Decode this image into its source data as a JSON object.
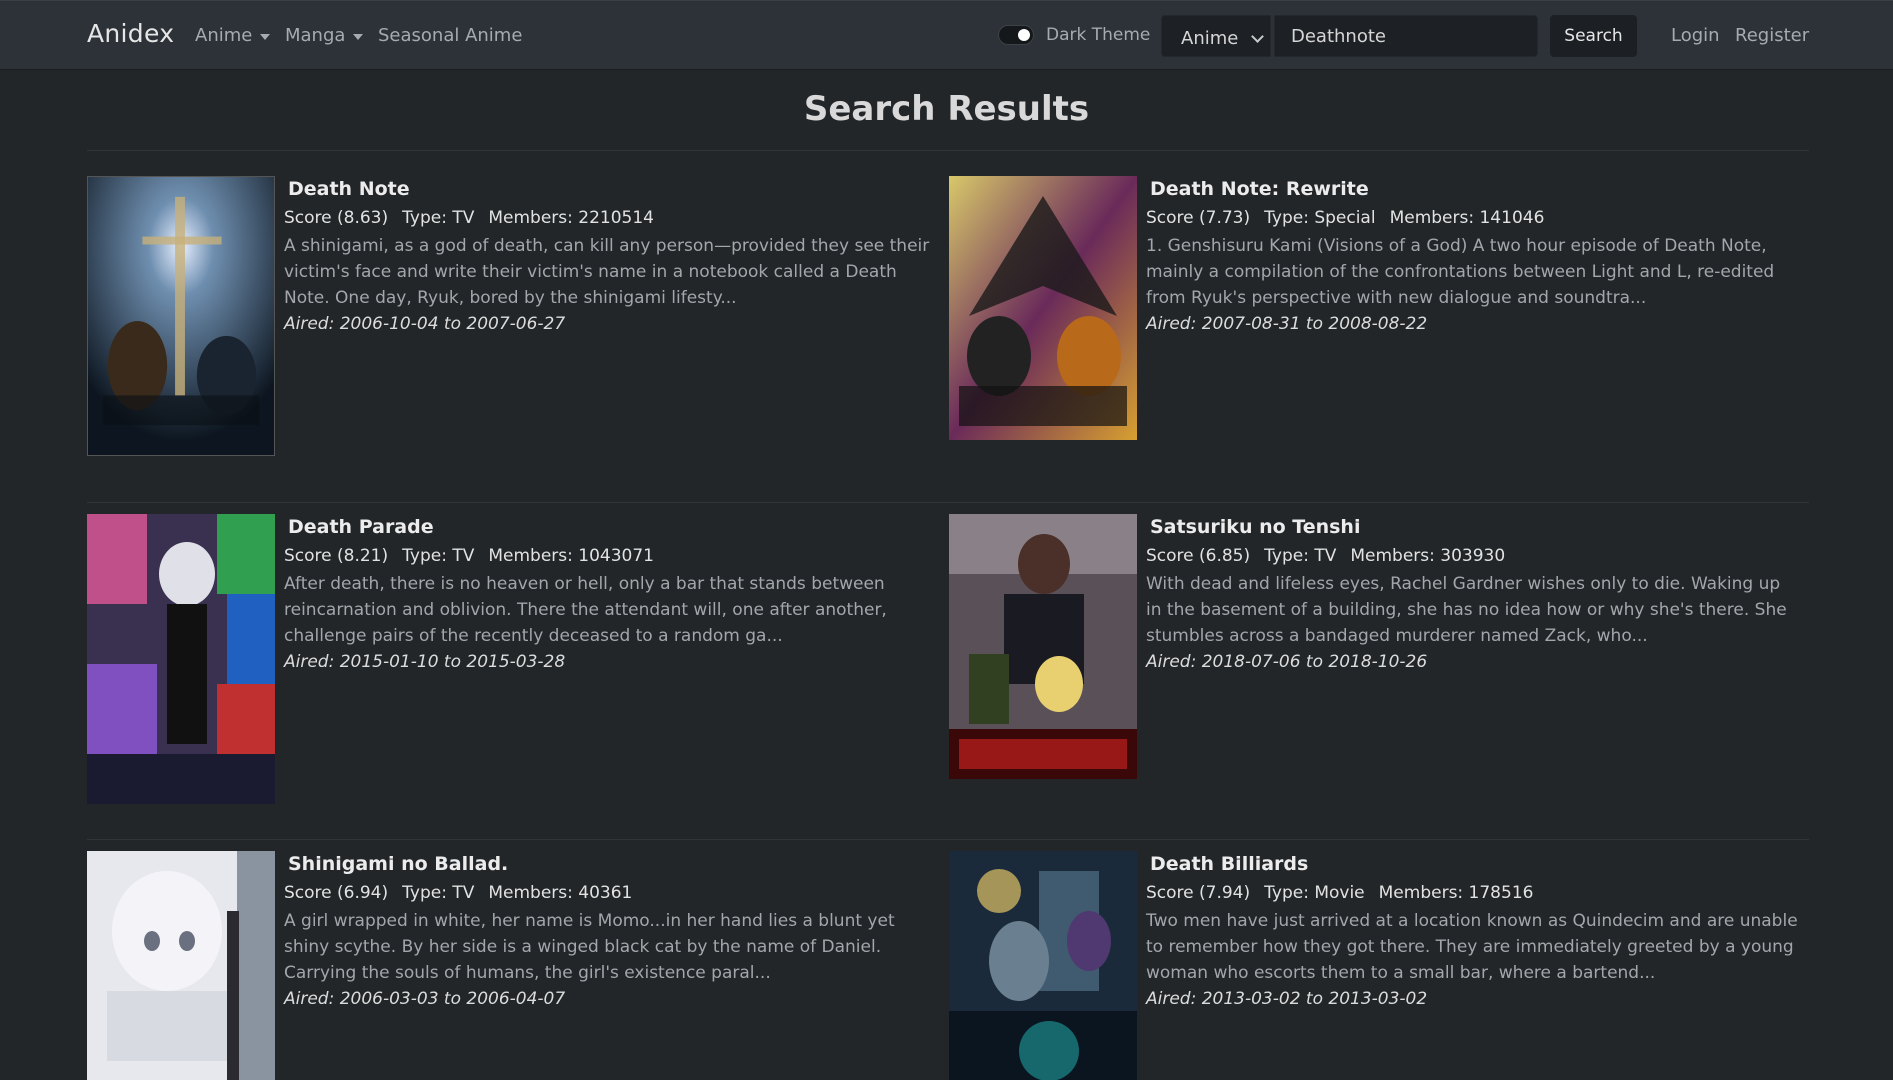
{
  "nav": {
    "brand": "Anidex",
    "links": [
      "Anime",
      "Manga",
      "Seasonal Anime"
    ],
    "theme_label": "Dark Theme",
    "search_type": "Anime",
    "search_value": "Deathnote",
    "search_button": "Search",
    "login": "Login",
    "register": "Register"
  },
  "page": {
    "title": "Search Results"
  },
  "results": [
    {
      "title": "Death Note",
      "score": "Score (8.63)",
      "type": "Type: TV",
      "members": "Members: 2210514",
      "synopsis": "A shinigami, as a god of death, can kill any person—provided they see their victim's face and write their victim's name in a notebook called a Death Note. One day, Ryuk, bored by the shinigami lifesty...",
      "aired": "Aired: 2006-10-04 to 2007-06-27"
    },
    {
      "title": "Death Note: Rewrite",
      "score": "Score (7.73)",
      "type": "Type: Special",
      "members": "Members: 141046",
      "synopsis": "1. Genshisuru Kami (Visions of a God) A two hour episode of Death Note, mainly a compilation of the confrontations between Light and L, re-edited from Ryuk's perspective with new dialogue and soundtra...",
      "aired": "Aired: 2007-08-31 to 2008-08-22"
    },
    {
      "title": "Death Parade",
      "score": "Score (8.21)",
      "type": "Type: TV",
      "members": "Members: 1043071",
      "synopsis": "After death, there is no heaven or hell, only a bar that stands between reincarnation and oblivion. There the attendant will, one after another, challenge pairs of the recently deceased to a random ga...",
      "aired": "Aired: 2015-01-10 to 2015-03-28"
    },
    {
      "title": "Satsuriku no Tenshi",
      "score": "Score (6.85)",
      "type": "Type: TV",
      "members": "Members: 303930",
      "synopsis": "With dead and lifeless eyes, Rachel Gardner wishes only to die. Waking up in the basement of a building, she has no idea how or why she's there. She stumbles across a bandaged murderer named Zack, who...",
      "aired": "Aired: 2018-07-06 to 2018-10-26"
    },
    {
      "title": "Shinigami no Ballad.",
      "score": "Score (6.94)",
      "type": "Type: TV",
      "members": "Members: 40361",
      "synopsis": "A girl wrapped in white, her name is Momo...in her hand lies a blunt yet shiny scythe. By her side is a winged black cat by the name of Daniel. Carrying the souls of humans, the girl's existence paral...",
      "aired": "Aired: 2006-03-03 to 2006-04-07"
    },
    {
      "title": "Death Billiards",
      "score": "Score (7.94)",
      "type": "Type: Movie",
      "members": "Members: 178516",
      "synopsis": "Two men have just arrived at a location known as Quindecim and are unable to remember how they got there. They are immediately greeted by a young woman who escorts them to a small bar, where a bartend...",
      "aired": "Aired: 2013-03-02 to 2013-03-02"
    }
  ]
}
